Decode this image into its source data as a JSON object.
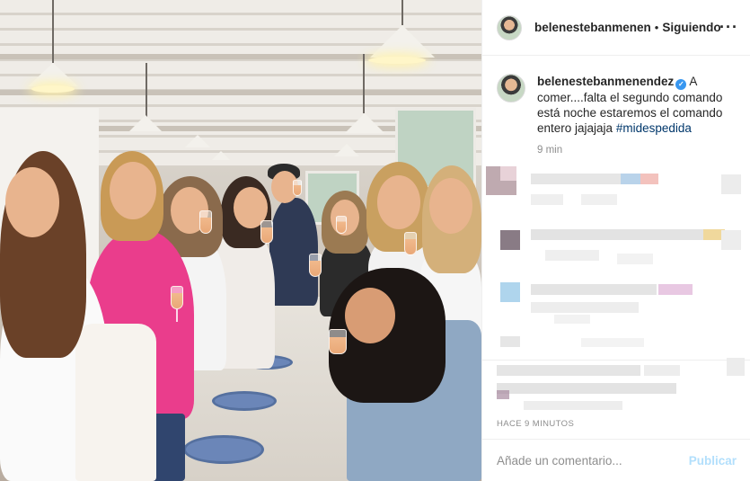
{
  "post": {
    "image_alt": "Grupo de mujeres brindando con copas de vino rosado en un restaurante",
    "header": {
      "username": "belenestebanmenen",
      "separator": "•",
      "follow_status": "Siguiendo",
      "more_icon": "more-horizontal-icon"
    },
    "caption": {
      "username": "belenestebanmenendez",
      "verified_icon": "verified-badge-icon",
      "text": "A comer....falta el segundo comando está noche estaremos el comando entero jajajaja",
      "hashtag": "#midespedida",
      "time": "9 min"
    },
    "timestamp": "HACE 9 MINUTOS",
    "comment_box": {
      "placeholder": "Añade un comentario...",
      "publish_label": "Publicar"
    },
    "colors": {
      "link": "#00376b",
      "verified": "#3897f0",
      "publish_disabled": "#b2dffc",
      "muted": "#8e8e8e"
    }
  }
}
